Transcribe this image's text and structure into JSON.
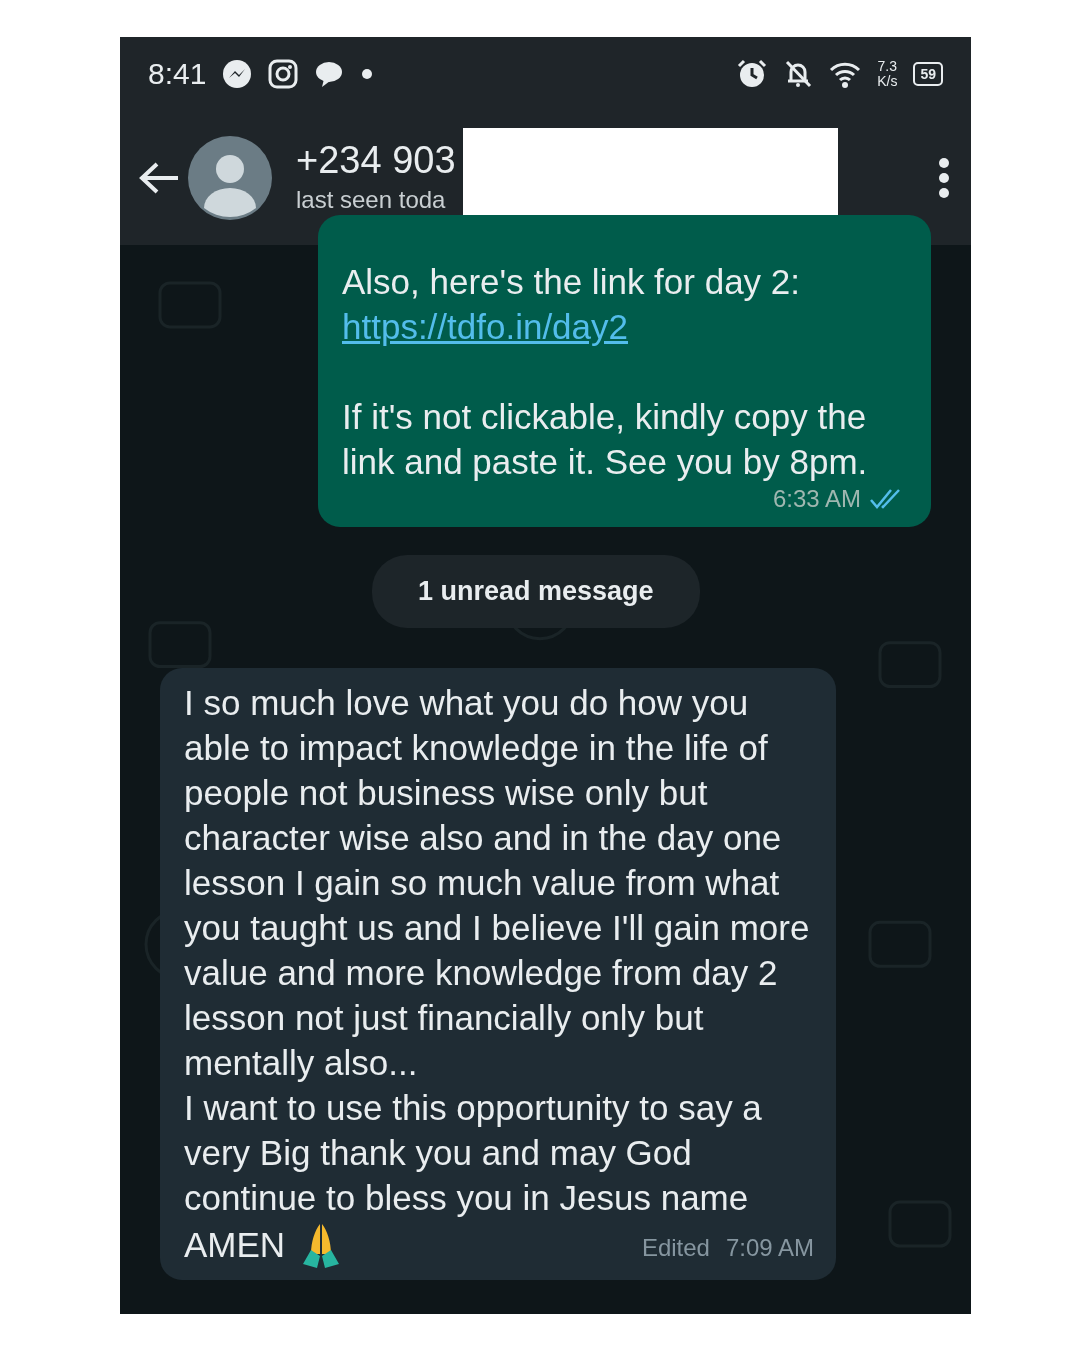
{
  "status_bar": {
    "time": "8:41",
    "speed_value": "7.3",
    "speed_unit": "K/s",
    "battery": "59"
  },
  "header": {
    "contact": "+234 903",
    "last_seen": "last seen toda",
    "redacted": true
  },
  "messages": [
    {
      "kind": "outgoing",
      "parts": [
        {
          "kind": "text",
          "text": "Also, here's the link for day 2:"
        },
        {
          "kind": "link",
          "text": "https://tdfo.in/day2"
        },
        {
          "kind": "text",
          "text": "If it's not clickable, kindly copy the link and paste it. See you by 8pm."
        }
      ],
      "time": "6:33 AM",
      "read": true
    },
    {
      "kind": "divider",
      "text": "1 unread message"
    },
    {
      "kind": "incoming",
      "text": "I so much love what you do how you able to impact knowledge in the life of people not business wise only but character wise also and in the day one lesson I gain so much value from what you taught us and I believe I'll gain more value and more knowledge from day 2 lesson not just financially only but mentally also...\nI want to use this opportunity to say a very Big thank you and may God continue to bless you in Jesus name",
      "closing": "AMEN",
      "edited_label": "Edited",
      "time": "7:09 AM"
    }
  ]
}
